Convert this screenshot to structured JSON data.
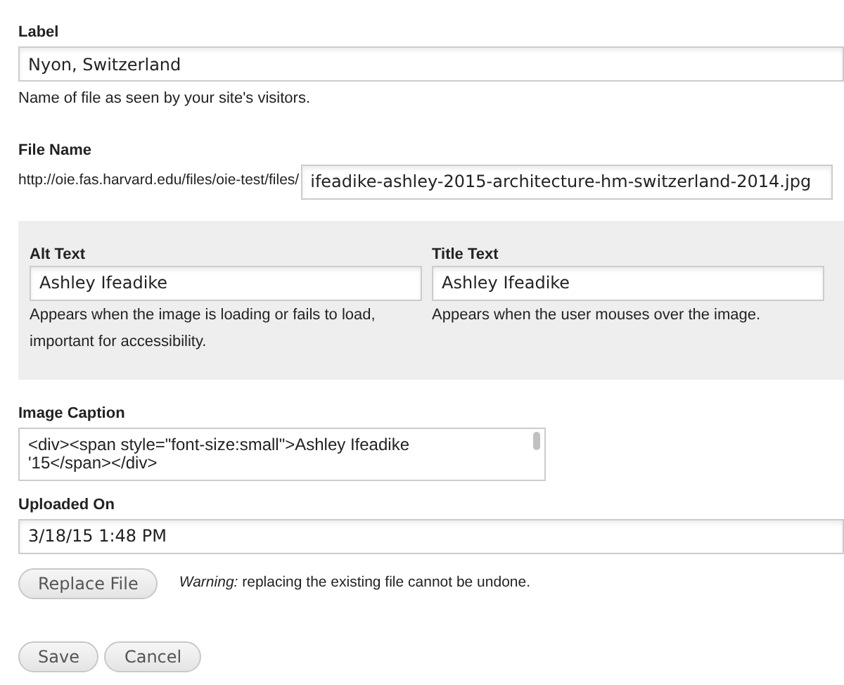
{
  "label_field": {
    "label": "Label",
    "value": "Nyon, Switzerland",
    "help": "Name of file as seen by your site's visitors."
  },
  "file_name": {
    "label": "File Name",
    "prefix": "http://oie.fas.harvard.edu/files/oie-test/files/",
    "value": "ifeadike-ashley-2015-architecture-hm-switzerland-2014.jpg"
  },
  "image_text": [
    {
      "label": "Alt Text",
      "value": "Ashley Ifeadike",
      "help": "Appears when the image is loading or fails to load, important for accessibility."
    },
    {
      "label": "Title Text",
      "value": "Ashley Ifeadike",
      "help": "Appears when the user mouses over the image."
    }
  ],
  "image_caption": {
    "label": "Image Caption",
    "value": "<div><span style=\"font-size:small\">Ashley Ifeadike '15</span></div>"
  },
  "uploaded_on": {
    "label": "Uploaded On",
    "value": "3/18/15 1:48 PM"
  },
  "replace": {
    "button": "Replace File",
    "warning": "*Warning:* replacing the existing file cannot be undone."
  },
  "buttons": [
    "Save",
    "Cancel"
  ]
}
